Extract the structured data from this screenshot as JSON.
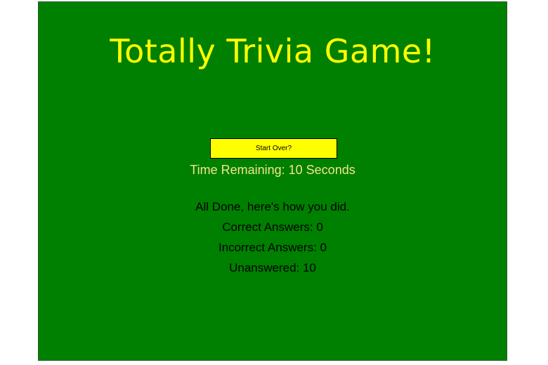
{
  "colors": {
    "panel_background": "#008000",
    "title_color": "#ffff00",
    "button_background": "#ffff00",
    "timer_color": "#f2e58a",
    "text_color": "#000000"
  },
  "header": {
    "title": "Totally Trivia Game!"
  },
  "controls": {
    "start_over_label": "Start Over?"
  },
  "timer": {
    "text": "Time Remaining: 10 Seconds",
    "seconds": 10
  },
  "results": {
    "summary": "All Done, here's how you did.",
    "correct": "Correct Answers: 0",
    "incorrect": "Incorrect Answers: 0",
    "unanswered": "Unanswered: 10"
  }
}
